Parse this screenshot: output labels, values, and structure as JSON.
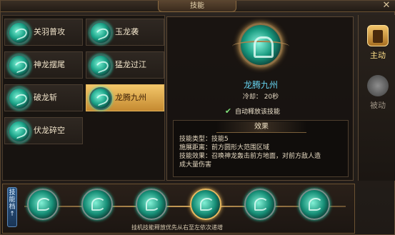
{
  "window": {
    "title": "技能",
    "close_symbol": "✕"
  },
  "skill_list": [
    {
      "label": "关羽普攻",
      "selected": false
    },
    {
      "label": "玉龙袭",
      "selected": false
    },
    {
      "label": "神龙摆尾",
      "selected": false
    },
    {
      "label": "猛龙过江",
      "selected": false
    },
    {
      "label": "破龙斩",
      "selected": false
    },
    {
      "label": "龙腾九州",
      "selected": true
    },
    {
      "label": "伏龙碎空",
      "selected": false
    }
  ],
  "detail": {
    "name": "龙腾九州",
    "cooldown": "冷却： 20秒",
    "auto_cast_checked": true,
    "auto_cast_label": "自动释放该技能",
    "effect_title": "效果",
    "lines": [
      "技能类型：技能5",
      "施展距离：前方圆形大范围区域",
      "技能效果：召唤神龙轰击前方地面，对前方敌人造",
      "成大量伤害"
    ]
  },
  "tabs": [
    {
      "label": "主动",
      "active": true,
      "icon": "book-icon"
    },
    {
      "label": "被动",
      "active": false,
      "icon": "meditation-icon"
    }
  ],
  "sequence_bar": {
    "label": "技能档",
    "arrow": "↑",
    "hint": "挂机技能释放优先从右至左依次递增",
    "slots": 6,
    "highlighted_index": 3
  },
  "colors": {
    "accent_gold": "#e0b45c",
    "skill_name": "#66d2ee",
    "teal": "#1ba388"
  }
}
